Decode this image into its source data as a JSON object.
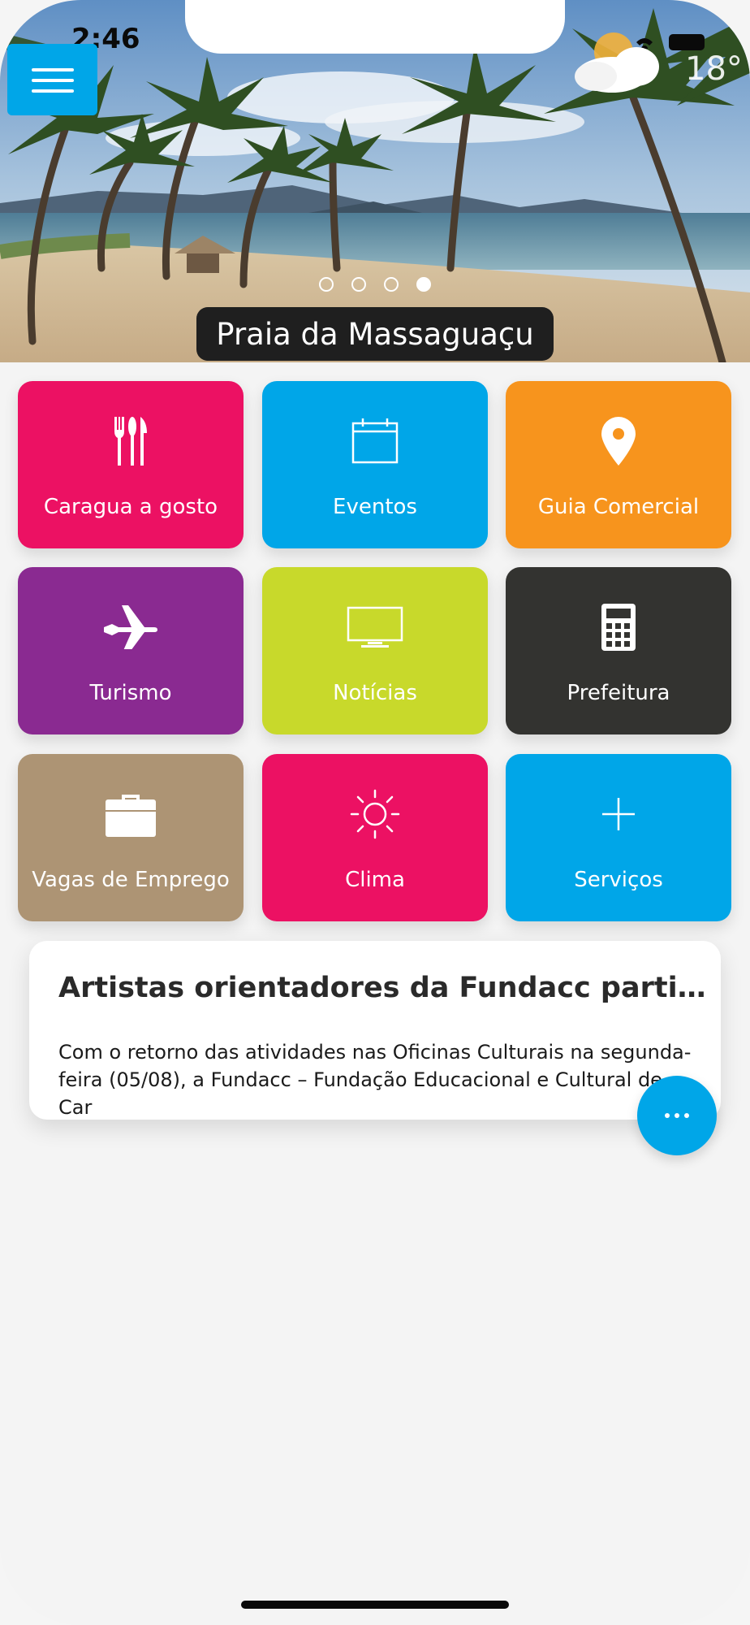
{
  "status": {
    "time": "2:46"
  },
  "hero": {
    "caption": "Praia da Massaguaçu",
    "temperature": "18°",
    "slides": 4,
    "active_slide": 4
  },
  "tiles": [
    {
      "label": "Caragua a gosto",
      "icon": "cutlery-icon",
      "color": "#ec1163"
    },
    {
      "label": "Eventos",
      "icon": "calendar-icon",
      "color": "#00a6e8"
    },
    {
      "label": "Guia Comercial",
      "icon": "map-pin-icon",
      "color": "#f7941d"
    },
    {
      "label": "Turismo",
      "icon": "airplane-icon",
      "color": "#8a2a91"
    },
    {
      "label": "Notícias",
      "icon": "tv-icon",
      "color": "#c8d92b"
    },
    {
      "label": "Prefeitura",
      "icon": "calculator-icon",
      "color": "#333330"
    },
    {
      "label": "Vagas de Emprego",
      "icon": "briefcase-icon",
      "color": "#ad9474"
    },
    {
      "label": "Clima",
      "icon": "sun-icon",
      "color": "#ec1163"
    },
    {
      "label": "Serviços",
      "icon": "plus-icon",
      "color": "#00a6e8"
    }
  ],
  "news": {
    "title": "Artistas orientadores da Fundacc particip...",
    "body": "Com o retorno das atividades nas Oficinas Culturais na segunda-feira (05/08), a Fundacc – Fundação Educacional e Cultural de Car"
  },
  "colors": {
    "accent": "#00a6e8",
    "background": "#f4f4f4"
  }
}
